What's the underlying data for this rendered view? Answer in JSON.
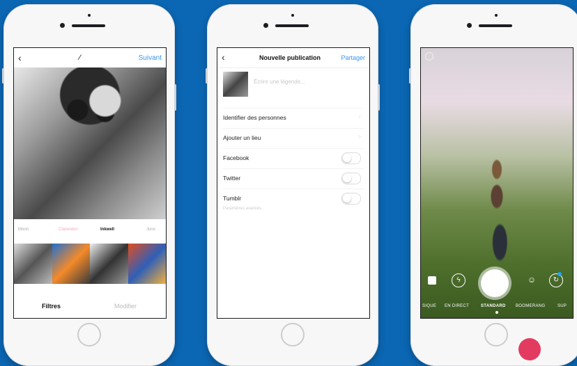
{
  "phone1": {
    "nav": {
      "back": "‹",
      "tool_icon": "magic-wand-icon",
      "next": "Suivant"
    },
    "filters": [
      {
        "name": "Moon"
      },
      {
        "name": "Clarendon"
      },
      {
        "name": "Inkwell"
      },
      {
        "name": "Juno"
      }
    ],
    "tabs": {
      "filter": "Filtres",
      "edit": "Modifier"
    }
  },
  "phone2": {
    "nav": {
      "back": "‹",
      "title": "Nouvelle publication",
      "share": "Partager"
    },
    "caption_placeholder": "Écrire une légende...",
    "options": {
      "tag": "Identifier des personnes",
      "location": "Ajouter un lieu",
      "facebook": "Facebook",
      "twitter": "Twitter",
      "tumblr": "Tumblr"
    },
    "advanced": "Paramètres avancés"
  },
  "phone3": {
    "modes": {
      "m1": "SIQUE",
      "m2": "EN DIRECT",
      "m3": "STANDARD",
      "m4": "BOOMERANG",
      "m5": "SUP"
    }
  },
  "colors": {
    "background": "#0b66b3",
    "accent_blue": "#3897f0",
    "badge": "#e33b60"
  }
}
